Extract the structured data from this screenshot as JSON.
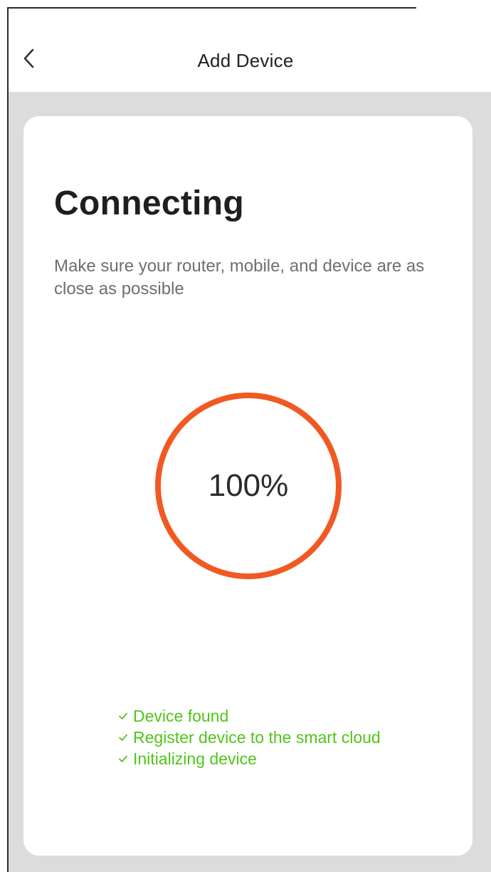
{
  "header": {
    "title": "Add Device",
    "back_icon": "chevron-left-icon"
  },
  "card": {
    "heading": "Connecting",
    "subtext": "Make sure your router, mobile, and device are as close as possible",
    "progress": {
      "value_percent": 100,
      "label": "100%",
      "color": "#f05a22"
    },
    "steps": [
      {
        "label": "Device found",
        "icon": "check-icon",
        "status": "done"
      },
      {
        "label": "Register device to the smart cloud",
        "icon": "check-icon",
        "status": "done"
      },
      {
        "label": "Initializing device",
        "icon": "check-icon",
        "status": "done"
      }
    ]
  },
  "colors": {
    "accent": "#f05a22",
    "success": "#52c41a",
    "background": "#dcdcdc"
  }
}
